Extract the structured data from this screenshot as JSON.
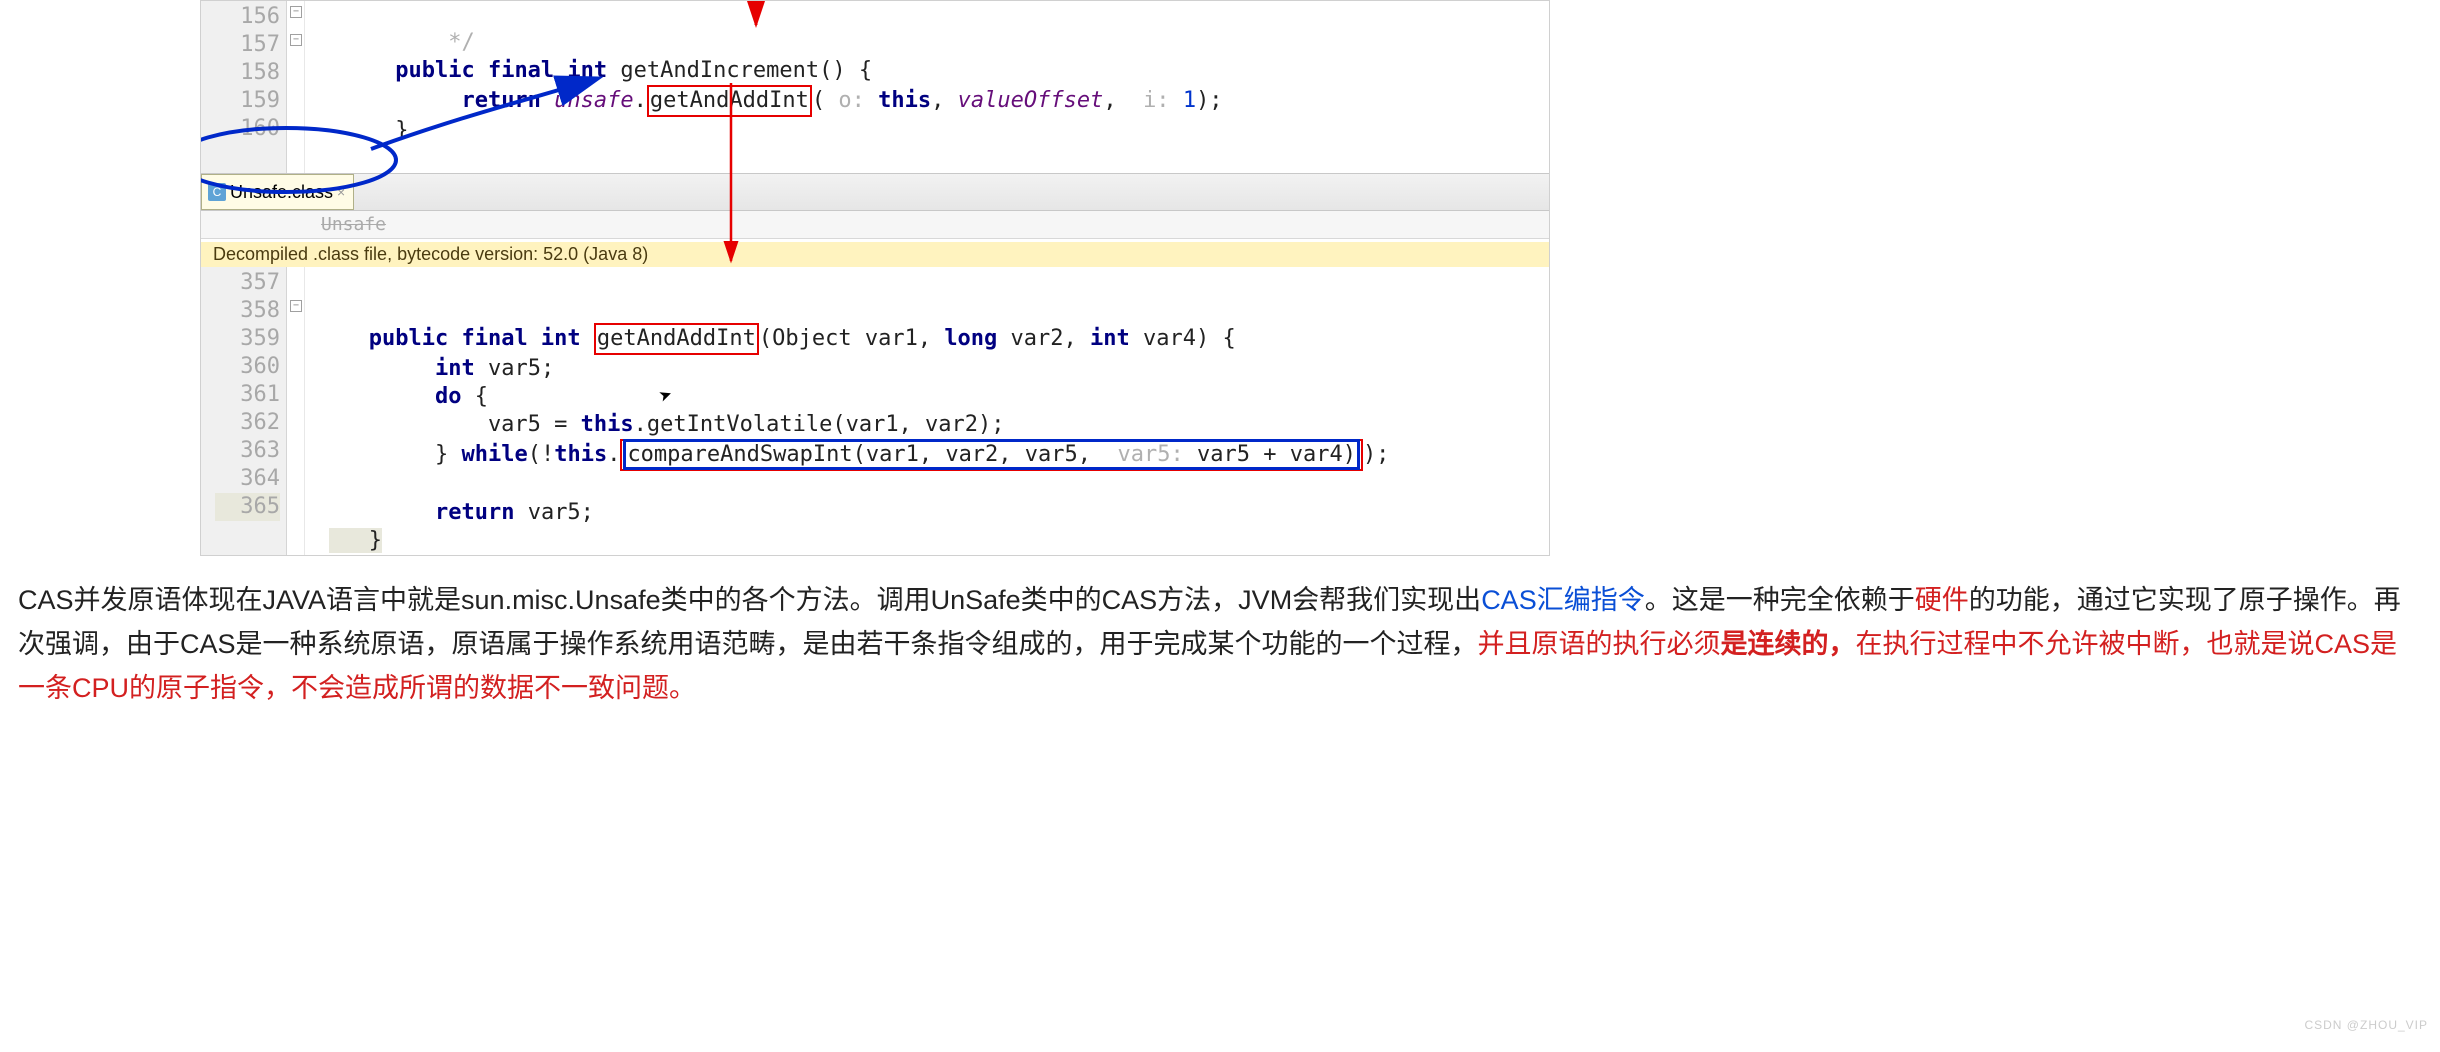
{
  "tab": {
    "filename": "Unsafe.class",
    "icon_letter": "C"
  },
  "breadcrumb": "Unsafe",
  "decompile_banner": "Decompiled .class file, bytecode version: 52.0 (Java 8)",
  "block1": {
    "line_numbers": [
      "156",
      "157",
      "158",
      "159",
      "160"
    ],
    "l156_comment_close": "*/",
    "l157": {
      "kw": "public final int",
      "method": "getAndIncrement",
      "sig_tail": "() {"
    },
    "l158": {
      "kw": "return",
      "obj": "unsafe",
      "dot": ".",
      "call": "getAndAddInt",
      "hint_o": "o:",
      "kw_this": "this",
      "comma": ", ",
      "field": "valueOffset",
      "hint_i": "i:",
      "val": "1",
      "tail": ");"
    },
    "l159": {
      "brace": "}"
    }
  },
  "block2": {
    "line_numbers": [
      "357",
      "358",
      "359",
      "360",
      "361",
      "362",
      "363",
      "364",
      "365"
    ],
    "l358": {
      "kw": "public final int",
      "method": "getAndAddInt",
      "sig_tail": "(Object var1, ",
      "kw2": "long",
      "arg2": " var2, ",
      "kw3": "int",
      "arg3": " var4) {"
    },
    "l359": {
      "kw": "int",
      "rest": " var5;"
    },
    "l360": {
      "kw": "do",
      "rest": " {"
    },
    "l361": {
      "indent": "            var5 = ",
      "kw": "this",
      "rest": ".getIntVolatile(var1, var2);"
    },
    "l362": {
      "brace": "} ",
      "kw": "while",
      "open": "(!",
      "kw2": "this",
      "dot": ".",
      "call": "compareAndSwapInt(var1, var2, var5, ",
      "hint": "var5:",
      "expr": " var5 + var4)",
      "tail": ");"
    },
    "l364": {
      "kw": "return",
      "rest": " var5;"
    },
    "l365": {
      "brace": "}"
    }
  },
  "explain": {
    "t1": "CAS并发原语体现在JAVA语言中就是sun.misc.Unsafe类中的各个方法。调用UnSafe类中的CAS方法，JVM会帮我们实现出",
    "t1b": "CAS汇编指令",
    "t2a": "。这是一种完全依赖于",
    "t2r": "硬件",
    "t2b": "的功能，通过它实现了原子操作。再次强调，由于CAS是一种系统原语，原语属于操作系统用语范畴，是由若干条指令组成的，用于完成某个功能的一个过程，",
    "t3r": "并且原语的执行必须",
    "t3rb": "是连续的，",
    "t3r2": "在执行过程中不允许被中断，也就是说CAS是一条CPU的原子指令，不会造成所谓的数据不一致问题。"
  },
  "watermark": "CSDN @ZHOU_VIP",
  "icons": {
    "fold_minus": "−",
    "fold_plus": "+",
    "close_x": "×"
  }
}
